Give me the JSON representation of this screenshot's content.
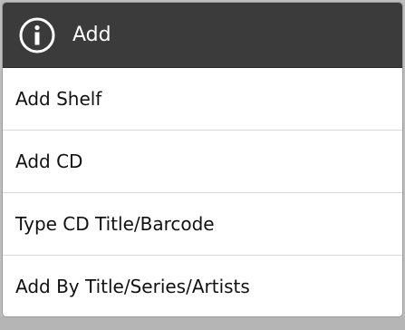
{
  "dialog": {
    "title": "Add",
    "icon": "info-icon",
    "items": [
      {
        "label": "Add Shelf"
      },
      {
        "label": "Add CD"
      },
      {
        "label": "Type CD Title/Barcode"
      },
      {
        "label": "Add By Title/Series/Artists"
      }
    ]
  },
  "colors": {
    "header_bg": "#3b3b3b",
    "dialog_bg": "#ffffff",
    "divider": "#dadada"
  }
}
